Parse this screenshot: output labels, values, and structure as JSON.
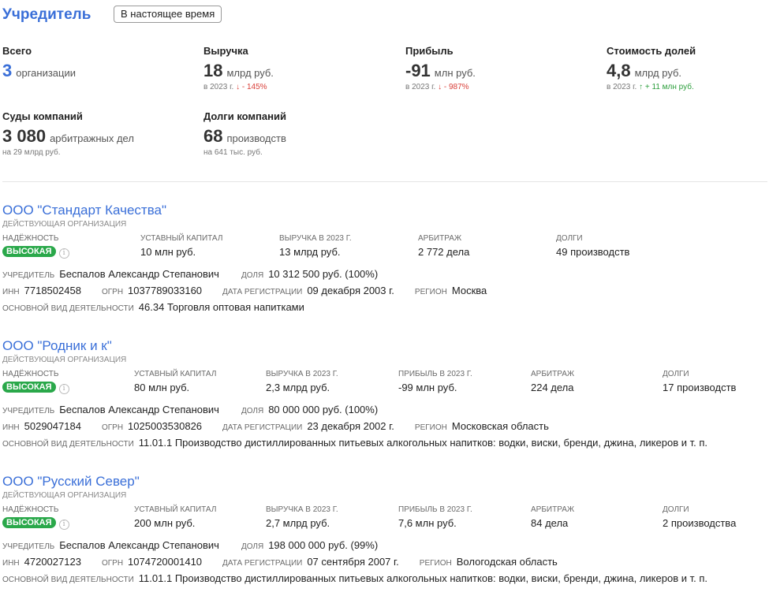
{
  "header": {
    "title": "Учредитель",
    "period_button": "В настоящее время"
  },
  "stats": {
    "total": {
      "label": "Всего",
      "value": "3",
      "unit": "организации"
    },
    "revenue": {
      "label": "Выручка",
      "value": "18",
      "unit": "млрд руб.",
      "sub_prefix": "в 2023 г.",
      "change": "↓ - 145%"
    },
    "profit": {
      "label": "Прибыль",
      "value": "-91",
      "unit": "млн руб.",
      "sub_prefix": "в 2023 г.",
      "change": "↓ - 987%"
    },
    "shares": {
      "label": "Стоимость долей",
      "value": "4,8",
      "unit": "млрд руб.",
      "sub_prefix": "в 2023 г.",
      "change": "↑ + 11 млн руб."
    },
    "courts": {
      "label": "Суды компаний",
      "value": "3 080",
      "unit": "арбитражных дел",
      "sub": "на 29 млрд руб."
    },
    "debts": {
      "label": "Долги компаний",
      "value": "68",
      "unit": "производств",
      "sub": "на 641 тыс. руб."
    }
  },
  "labels": {
    "reliability": "надёжность",
    "capital": "уставный капитал",
    "revenue": "выручка в 2023 г.",
    "profit": "прибыль в 2023 г.",
    "arbitration": "арбитраж",
    "debts": "долги",
    "founder": "учредитель",
    "share": "доля",
    "inn": "инн",
    "ogrn": "огрн",
    "reg_date": "дата регистрации",
    "region": "регион",
    "activity": "основной вид деятельности",
    "info_icon": "i"
  },
  "orgs": [
    {
      "name": "ООО \"Стандарт Качества\"",
      "status": "ДЕЙСТВУЮЩАЯ ОРГАНИЗАЦИЯ",
      "reliability": "ВЫСОКАЯ",
      "capital": "10 млн руб.",
      "revenue": "13 млрд руб.",
      "arbitration": "2 772 дела",
      "debts": "49 производств",
      "founder": "Беспалов Александр Степанович",
      "share": "10 312 500 руб. (100%)",
      "inn": "7718502458",
      "ogrn": "1037789033160",
      "reg_date": "09 декабря 2003 г.",
      "region": "Москва",
      "activity": "46.34 Торговля оптовая напитками"
    },
    {
      "name": "ООО \"Родник и к\"",
      "status": "ДЕЙСТВУЮЩАЯ ОРГАНИЗАЦИЯ",
      "reliability": "ВЫСОКАЯ",
      "capital": "80 млн руб.",
      "revenue": "2,3 млрд руб.",
      "profit": "-99 млн руб.",
      "arbitration": "224 дела",
      "debts": "17 производств",
      "founder": "Беспалов Александр Степанович",
      "share": "80 000 000 руб. (100%)",
      "inn": "5029047184",
      "ogrn": "1025003530826",
      "reg_date": "23 декабря 2002 г.",
      "region": "Московская область",
      "activity": "11.01.1 Производство дистиллированных питьевых алкогольных напитков: водки, виски, бренди, джина, ликеров и т. п."
    },
    {
      "name": "ООО \"Русский Север\"",
      "status": "ДЕЙСТВУЮЩАЯ ОРГАНИЗАЦИЯ",
      "reliability": "ВЫСОКАЯ",
      "capital": "200 млн руб.",
      "revenue": "2,7 млрд руб.",
      "profit": "7,6 млн руб.",
      "arbitration": "84 дела",
      "debts": "2 производства",
      "founder": "Беспалов Александр Степанович",
      "share": "198 000 000 руб. (99%)",
      "inn": "4720027123",
      "ogrn": "1074720001410",
      "reg_date": "07 сентября 2007 г.",
      "region": "Вологодская область",
      "activity": "11.01.1 Производство дистиллированных питьевых алкогольных напитков: водки, виски, бренди, джина, ликеров и т. п."
    }
  ],
  "colors": {
    "accent": "#3a6fd8",
    "badge": "#2aa84a",
    "negative": "#d9403a",
    "positive": "#2a9d3a"
  }
}
